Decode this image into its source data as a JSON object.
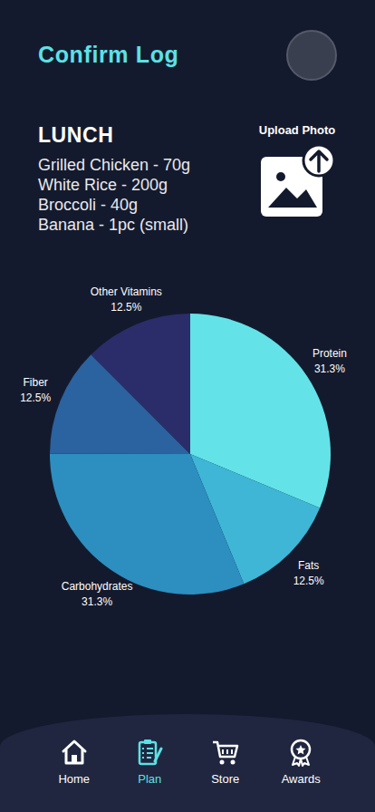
{
  "page": {
    "title": "Confirm Log"
  },
  "meal": {
    "name": "LUNCH",
    "items": [
      "Grilled Chicken - 70g",
      "White Rice - 200g",
      "Broccoli - 40g",
      "Banana - 1pc (small)"
    ]
  },
  "upload": {
    "label": "Upload Photo"
  },
  "chart": {
    "slices": [
      {
        "label": "Protein",
        "reading": "31.3%",
        "value": 31.3,
        "color": "#63e3e8"
      },
      {
        "label": "Fats",
        "reading": "12.5%",
        "value": 12.5,
        "color": "#3fb6d6"
      },
      {
        "label": "Carbohydrates",
        "reading": "31.3%",
        "value": 31.3,
        "color": "#2d8ec0"
      },
      {
        "label": "Fiber",
        "reading": "12.5%",
        "value": 12.5,
        "color": "#2b62a0"
      },
      {
        "label": "Other Vitamins",
        "reading": "12.5%",
        "value": 12.5,
        "color": "#2b2d6a"
      }
    ]
  },
  "nav": [
    {
      "label": "Home",
      "kind": "home",
      "selected": false
    },
    {
      "label": "Plan",
      "kind": "plan",
      "selected": true
    },
    {
      "label": "Store",
      "kind": "store",
      "selected": false
    },
    {
      "label": "Awards",
      "kind": "awards",
      "selected": false
    }
  ]
}
